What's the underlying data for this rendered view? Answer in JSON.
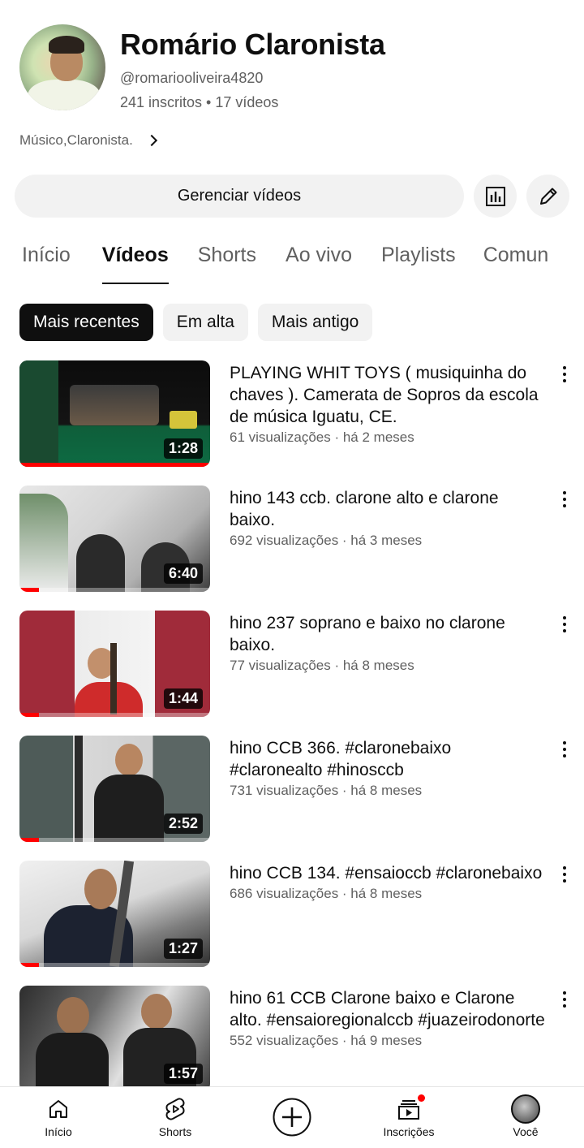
{
  "channel": {
    "name": "Romário Claronista",
    "handle": "@romariooliveira4820",
    "stats": "241 inscritos • 17 vídeos",
    "description": "Músico,Claronista."
  },
  "actions": {
    "manage_label": "Gerenciar vídeos",
    "stats_icon": "bar-chart-icon",
    "edit_icon": "pencil-icon"
  },
  "tabs": [
    {
      "label": "Início",
      "active": false
    },
    {
      "label": "Vídeos",
      "active": true
    },
    {
      "label": "Shorts",
      "active": false
    },
    {
      "label": "Ao vivo",
      "active": false
    },
    {
      "label": "Playlists",
      "active": false
    },
    {
      "label": "Comun",
      "active": false
    }
  ],
  "chips": [
    {
      "label": "Mais recentes",
      "active": true
    },
    {
      "label": "Em alta",
      "active": false
    },
    {
      "label": "Mais antigo",
      "active": false
    }
  ],
  "videos": [
    {
      "title": "PLAYING WHIT TOYS ( musiquinha do chaves ). Camerata de Sopros da escola de música Iguatu, CE.",
      "meta": "61 visualizações · há 2 meses",
      "duration": "1:28",
      "watched": 1.0
    },
    {
      "title": "hino 143 ccb. clarone alto e clarone baixo.",
      "meta": "692 visualizações · há 3 meses",
      "duration": "6:40",
      "watched": 0.1
    },
    {
      "title": "hino 237 soprano e baixo no clarone baixo.",
      "meta": "77 visualizações · há 8 meses",
      "duration": "1:44",
      "watched": 0.1
    },
    {
      "title": "hino CCB 366. #claronebaixo #claronealto #hinosccb",
      "meta": "731 visualizações · há 8 meses",
      "duration": "2:52",
      "watched": 0.1
    },
    {
      "title": "hino CCB 134. #ensaioccb #claronebaixo",
      "meta": "686 visualizações · há 8 meses",
      "duration": "1:27",
      "watched": 0.1
    },
    {
      "title": "hino 61 CCB Clarone baixo e Clarone alto. #ensaioregionalccb #juazeirodonorte",
      "meta": "552 visualizações · há 9 meses",
      "duration": "1:57",
      "watched": 0.0
    }
  ],
  "bottom_nav": [
    {
      "label": "Início",
      "icon": "home-icon"
    },
    {
      "label": "Shorts",
      "icon": "shorts-icon"
    },
    {
      "label": "",
      "icon": "create-plus-icon"
    },
    {
      "label": "Inscrições",
      "icon": "subscriptions-icon"
    },
    {
      "label": "Você",
      "icon": "avatar-icon"
    }
  ],
  "colors": {
    "accent": "#ff0000",
    "text_primary": "#0f0f0f",
    "text_secondary": "#606060",
    "chip_bg": "#f2f2f2"
  }
}
